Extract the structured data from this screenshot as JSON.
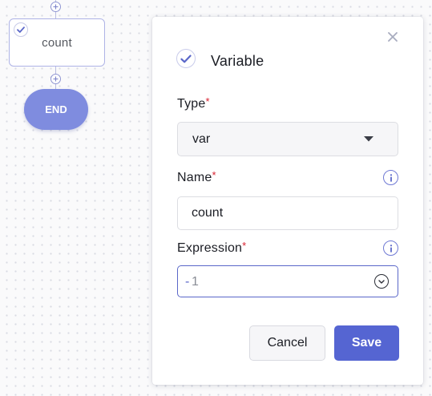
{
  "canvas": {
    "step_node": {
      "label": "count",
      "icon": "check-circle-icon"
    },
    "end_node": {
      "label": "END"
    },
    "accent_color": "#7f8cdf"
  },
  "dialog": {
    "title": "Variable",
    "title_icon": "check-circle-icon",
    "close_icon": "close-icon",
    "fields": {
      "type": {
        "label": "Type",
        "required_mark": "*",
        "value": "var"
      },
      "name": {
        "label": "Name",
        "required_mark": "*",
        "value": "count",
        "info_icon": "info-icon"
      },
      "expression": {
        "label": "Expression",
        "required_mark": "*",
        "cursor": "-",
        "value": "1",
        "info_icon": "info-icon"
      }
    },
    "buttons": {
      "cancel": "Cancel",
      "save": "Save"
    },
    "primary_color": "#5565d2",
    "required_color": "#d8202f"
  }
}
